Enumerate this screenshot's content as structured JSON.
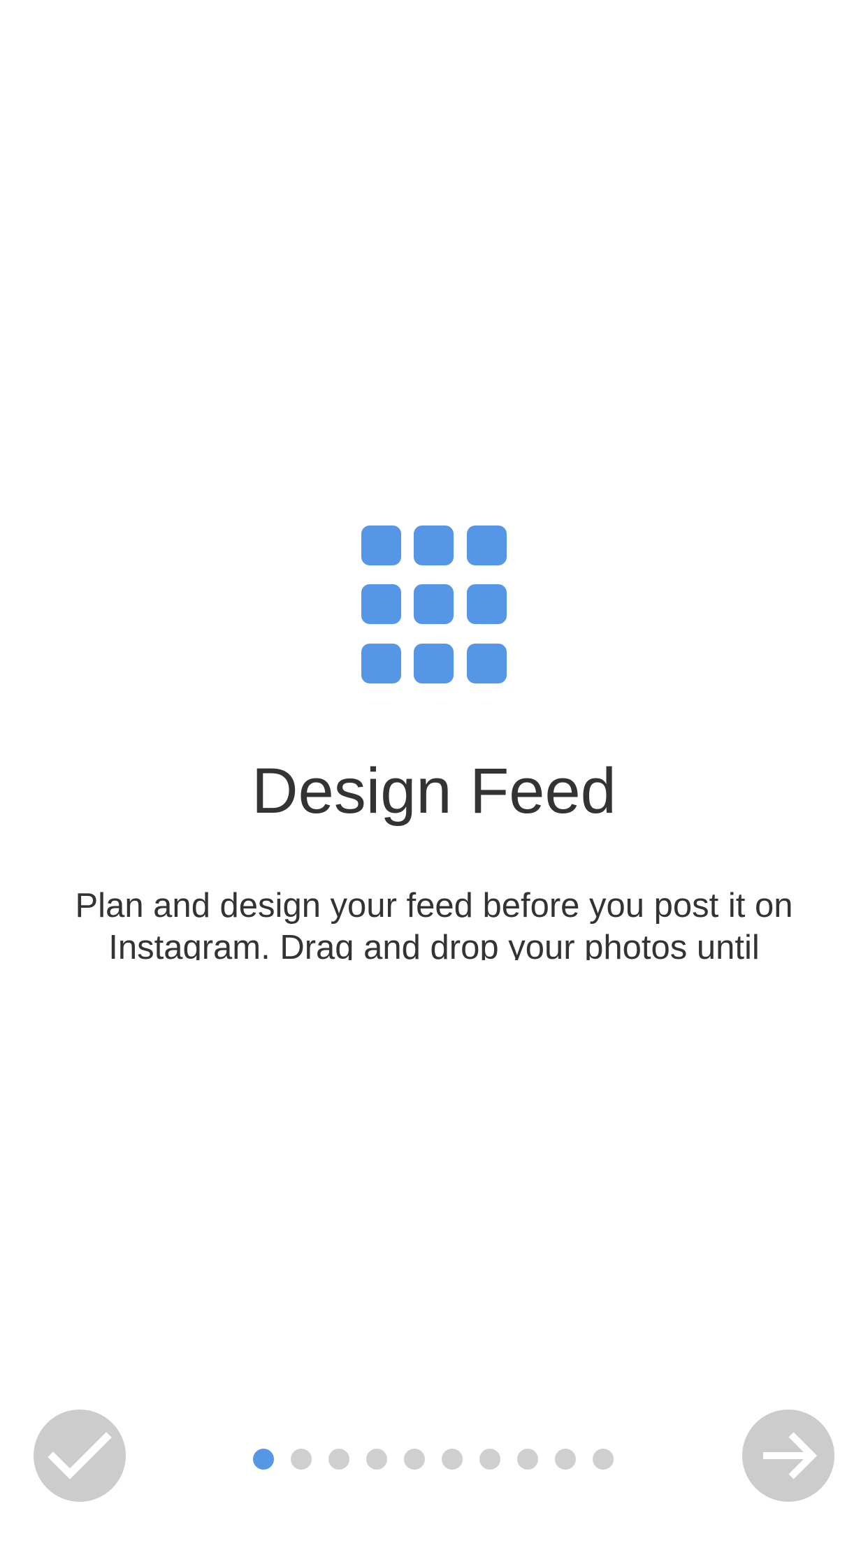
{
  "onboarding": {
    "title": "Design Feed",
    "description": "Plan and design your feed before you post it on Instagram. Drag and drop your photos until"
  },
  "icons": {
    "feature": "grid-icon",
    "done": "checkmark-icon",
    "next": "arrow-right-icon"
  },
  "pager": {
    "total_pages": 10,
    "current_page": 1
  },
  "colors": {
    "accent": "#5597e6",
    "button_bg": "#cccccc",
    "dot_inactive": "#cfcfcf",
    "text": "#333333",
    "background": "#ffffff"
  }
}
